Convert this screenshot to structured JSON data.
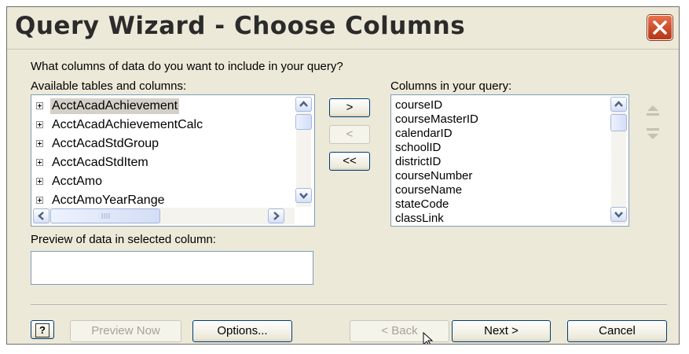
{
  "window": {
    "title": "Query Wizard - Choose Columns"
  },
  "prompt": "What columns of data do you want to include in your query?",
  "available": {
    "label": "Available tables and columns:",
    "items": [
      {
        "label": "AcctAcadAchievement",
        "selected": true
      },
      {
        "label": "AcctAcadAchievementCalc",
        "selected": false
      },
      {
        "label": "AcctAcadStdGroup",
        "selected": false
      },
      {
        "label": "AcctAcadStdItem",
        "selected": false
      },
      {
        "label": "AcctAmo",
        "selected": false
      },
      {
        "label": "AcctAmoYearRange",
        "selected": false
      }
    ]
  },
  "query_columns": {
    "label": "Columns in your query:",
    "items": [
      "courseID",
      "courseMasterID",
      "calendarID",
      "schoolID",
      "districtID",
      "courseNumber",
      "courseName",
      "stateCode",
      "classLink"
    ]
  },
  "move_buttons": {
    "add": ">",
    "remove": "<",
    "remove_all": "<<"
  },
  "preview": {
    "label": "Preview of data in selected column:",
    "value": ""
  },
  "footer": {
    "help": "?",
    "preview_now": "Preview Now",
    "options": "Options...",
    "back": "< Back",
    "next": "Next >",
    "cancel": "Cancel"
  },
  "colors": {
    "dialog_bg": "#ECE9D8",
    "close_red": "#C94A28",
    "list_border": "#7F9DB9"
  }
}
